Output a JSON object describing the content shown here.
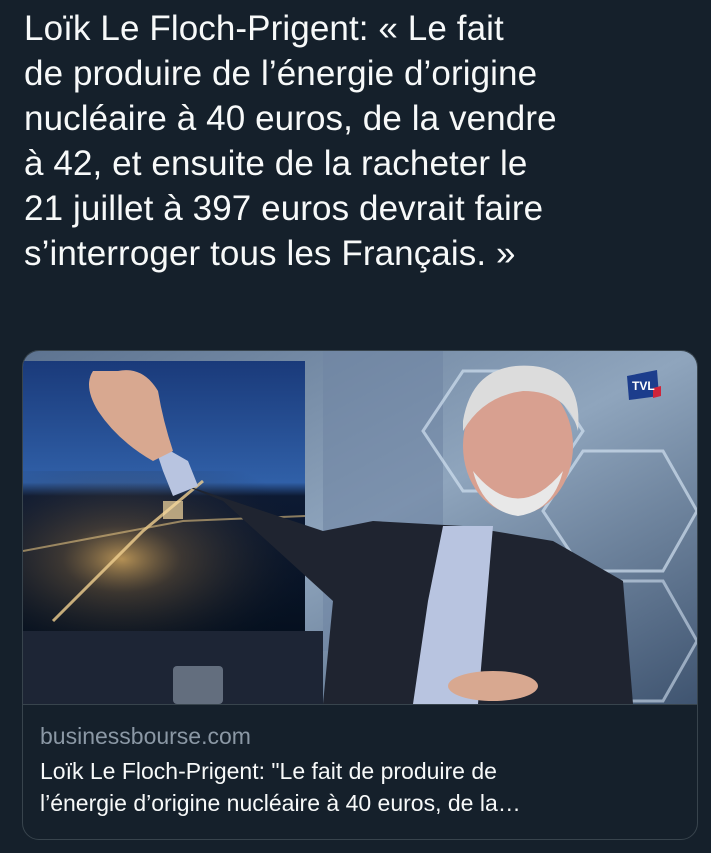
{
  "tweet": {
    "text": "Loïk Le Floch-Prigent: « Le fait\nde produire de l’énergie d’origine\nnucléaire à 40 euros, de la vendre\nà 42, et ensuite de la racheter le\n21 juillet à 397 euros devrait faire\ns’interroger tous les Français. »"
  },
  "link_card": {
    "domain": "businessbourse.com",
    "title": "Loïk Le Floch-Prigent: \"Le fait de produire de\nl’énergie d’origine nucléaire à 40 euros, de la…",
    "image_alt": "Man with white hair and beard in dark suit gesturing in a TV studio, night city view on screen behind",
    "channel_logo": "TVL"
  },
  "colors": {
    "background": "#15202b",
    "text": "#f7f9f9",
    "muted": "#8b98a5",
    "border": "#38444d"
  }
}
